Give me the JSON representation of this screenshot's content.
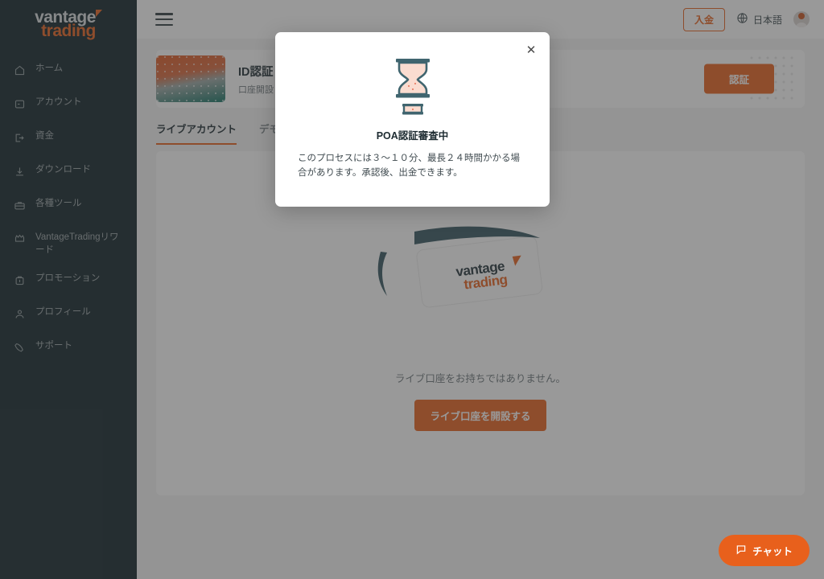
{
  "brand": {
    "logo_top": "vantage",
    "logo_bottom": "trading",
    "accent_color": "#e8601c",
    "sidebar_color": "#0d2027"
  },
  "sidebar": {
    "items": [
      {
        "icon": "home-icon",
        "label": "ホーム"
      },
      {
        "icon": "account-icon",
        "label": "アカウント"
      },
      {
        "icon": "funds-icon",
        "label": "資金"
      },
      {
        "icon": "download-icon",
        "label": "ダウンロード"
      },
      {
        "icon": "tools-icon",
        "label": "各種ツール"
      },
      {
        "icon": "rewards-icon",
        "label": "VantageTradingリワード"
      },
      {
        "icon": "promotion-icon",
        "label": "プロモーション"
      },
      {
        "icon": "profile-icon",
        "label": "プロフィール"
      },
      {
        "icon": "support-icon",
        "label": "サポート"
      }
    ]
  },
  "topbar": {
    "menu_icon": "hamburger-icon",
    "deposit_label": "入金",
    "language_icon": "globe-icon",
    "language_label": "日本語",
    "avatar_icon": "avatar"
  },
  "banner": {
    "title": "ID認証",
    "subtitle": "口座開設と取引を開始するために本人確認を完了してください",
    "button_label": "認証"
  },
  "tabs": [
    {
      "label": "ライブアカウント",
      "active": true
    },
    {
      "label": "デモ口座",
      "active": false
    }
  ],
  "panel": {
    "illustration": "vantage-trading-card-illustration",
    "empty_text": "ライブ口座をお持ちではありません。",
    "cta_label": "ライブ口座を開設する"
  },
  "chat": {
    "icon": "chat-bubble-icon",
    "label": "チャット"
  },
  "modal": {
    "visible": true,
    "icon": "hourglass-icon",
    "close_icon": "close-icon",
    "title": "POA認証審査中",
    "description": "このプロセスには３〜１０分、最長２４時間かかる場合があります。承認後、出金できます。"
  }
}
